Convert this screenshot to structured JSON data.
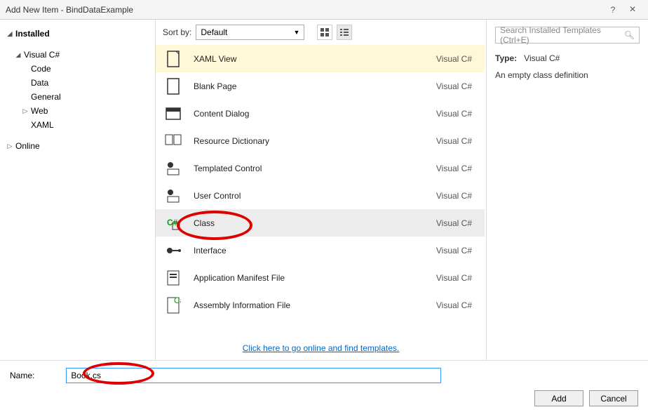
{
  "titlebar": {
    "title": "Add New Item - BindDataExample",
    "help": "?",
    "close": "×"
  },
  "sidebar": {
    "installed": "Installed",
    "csharp": "Visual C#",
    "children": [
      "Code",
      "Data",
      "General",
      "Web",
      "XAML"
    ],
    "online": "Online"
  },
  "sortbar": {
    "label": "Sort by:",
    "value": "Default"
  },
  "items": [
    {
      "label": "XAML View",
      "lang": "Visual C#",
      "highlight": true
    },
    {
      "label": "Blank Page",
      "lang": "Visual C#"
    },
    {
      "label": "Content Dialog",
      "lang": "Visual C#"
    },
    {
      "label": "Resource Dictionary",
      "lang": "Visual C#"
    },
    {
      "label": "Templated Control",
      "lang": "Visual C#"
    },
    {
      "label": "User Control",
      "lang": "Visual C#"
    },
    {
      "label": "Class",
      "lang": "Visual C#",
      "selected": true
    },
    {
      "label": "Interface",
      "lang": "Visual C#"
    },
    {
      "label": "Application Manifest File",
      "lang": "Visual C#"
    },
    {
      "label": "Assembly Information File",
      "lang": "Visual C#"
    }
  ],
  "link": "Click here to go online and find templates.",
  "right": {
    "search_placeholder": "Search Installed Templates (Ctrl+E)",
    "type_label": "Type:",
    "type_value": "Visual C#",
    "desc": "An empty class definition"
  },
  "bottom": {
    "name_label": "Name:",
    "name_value": "Book.cs",
    "add": "Add",
    "cancel": "Cancel"
  }
}
